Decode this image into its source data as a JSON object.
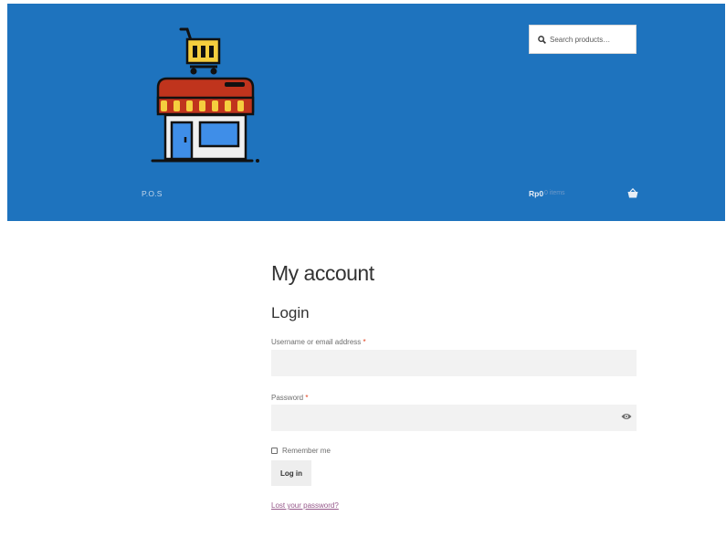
{
  "header": {
    "site_title": "P.O.S",
    "search": {
      "placeholder": "Search products…"
    },
    "cart": {
      "total": "Rp0",
      "count": "0 items"
    },
    "colors": {
      "background": "#1e73be"
    }
  },
  "main": {
    "page_title": "My account",
    "login_heading": "Login",
    "username": {
      "label": "Username or email address",
      "required_mark": "*",
      "value": ""
    },
    "password": {
      "label": "Password",
      "required_mark": "*",
      "value": ""
    },
    "remember_label": "Remember me",
    "login_button": "Log in",
    "lost_password_link": "Lost your password?"
  },
  "icons": [
    "store-logo-icon",
    "search-icon",
    "basket-icon",
    "eye-icon"
  ]
}
